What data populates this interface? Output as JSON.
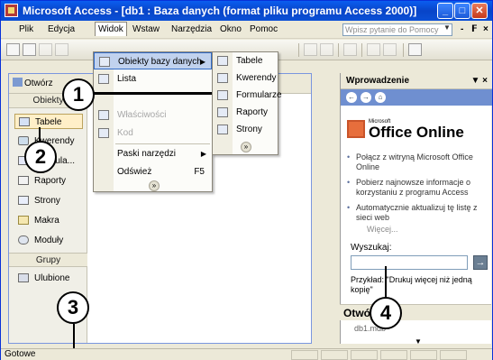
{
  "window": {
    "title": "Microsoft Access - [db1 : Baza danych (format pliku programu Access 2000)]",
    "minimize": "_",
    "maximize": "□",
    "close": "✕"
  },
  "menubar": {
    "items": [
      "Plik",
      "Edycja",
      "Widok",
      "Wstaw",
      "Narzędzia",
      "Okno",
      "Pomoc"
    ],
    "active": "Widok",
    "help_placeholder": "Wpisz pytanie do Pomocy",
    "mdi_controls": [
      "-",
      "𝗙",
      "×"
    ]
  },
  "view_menu": {
    "items": [
      {
        "label": "Obiekty bazy danych",
        "submenu": true,
        "highlight": true
      },
      {
        "label": "Lista"
      },
      {
        "label": "Właściwości",
        "disabled": true
      },
      {
        "label": "Kod",
        "disabled": true
      },
      {
        "label": "Paski narzędzi",
        "submenu": true
      },
      {
        "label": "Odśwież",
        "shortcut": "F5"
      }
    ],
    "expand": "»"
  },
  "objects_submenu": {
    "items": [
      "Tabele",
      "Kwerendy",
      "Formularze",
      "Raporty",
      "Strony"
    ],
    "expand": "»"
  },
  "db_window": {
    "open_label": "Otwórz",
    "objects_header": "Obiekty",
    "nav_items": [
      {
        "label": "Tabele",
        "icon": "table-icon",
        "selected": true
      },
      {
        "label": "Kwerendy",
        "icon": "query-icon"
      },
      {
        "label": "Formula...",
        "icon": "form-icon"
      },
      {
        "label": "Raporty",
        "icon": "report-icon"
      },
      {
        "label": "Strony",
        "icon": "page-icon"
      },
      {
        "label": "Makra",
        "icon": "macro-icon"
      },
      {
        "label": "Moduły",
        "icon": "module-icon"
      }
    ],
    "groups_header": "Grupy",
    "groups": [
      {
        "label": "Ulubione",
        "icon": "favorites-icon"
      }
    ]
  },
  "task_pane": {
    "title": "Wprowadzenie",
    "controls": "▼ ×",
    "nav": [
      "←",
      "→",
      "⌂"
    ],
    "logo_small": "Microsoft",
    "logo_text": "Office Online",
    "bullets": [
      "Połącz z witryną Microsoft Office Online",
      "Pobierz najnowsze informacje o korzystaniu z programu Access",
      "Automatycznie aktualizuj tę listę z sieci web"
    ],
    "more": "Więcej...",
    "search_label": "Wyszukaj:",
    "search_value": "",
    "search_go": "→",
    "example": "Przykład: \"Drukuj więcej niż jedną kopię\"",
    "section_title": "Otwórz",
    "section_item": "db1.mdb"
  },
  "statusbar": {
    "text": "Gotowe"
  },
  "callouts": [
    "1",
    "2",
    "3",
    "4"
  ],
  "colors": {
    "titlebar": "#0a5ef0",
    "menu_highlight": "#c1d2ee",
    "task_nav": "#6f8fd0",
    "selected_item": "#ffefc8"
  }
}
